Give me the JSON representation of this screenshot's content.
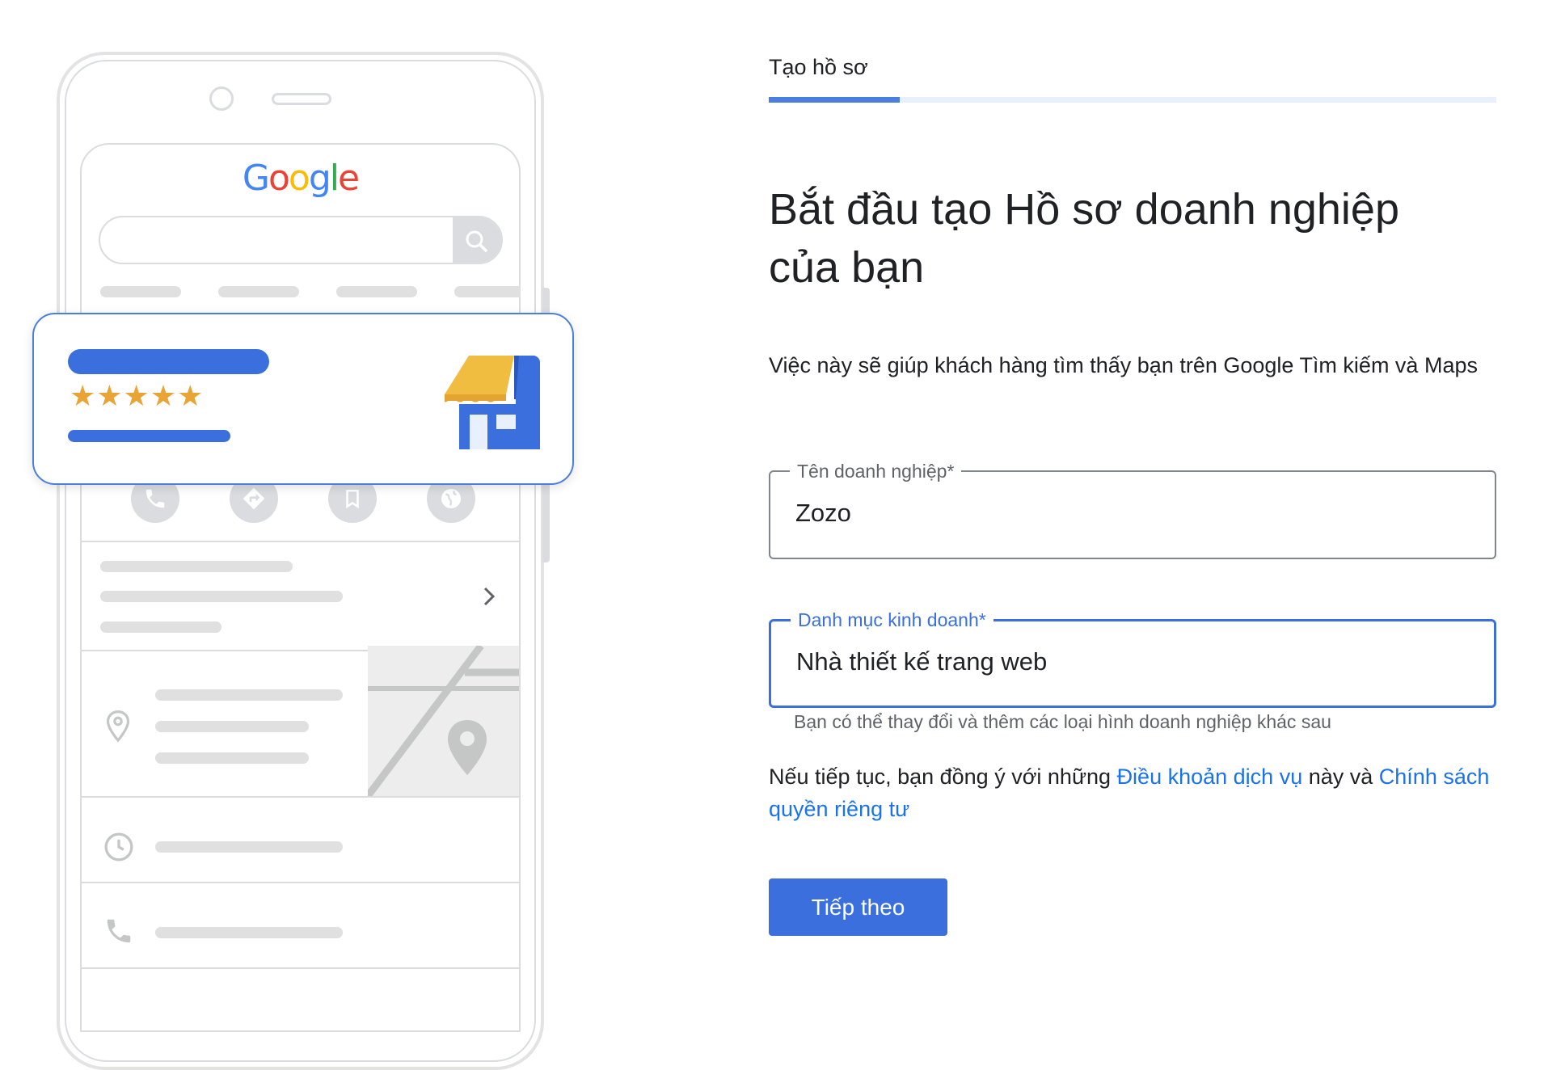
{
  "illustration": {
    "logo_text": "Google",
    "logo_colors": [
      "#4285F4",
      "#EA4335",
      "#FBBC05",
      "#4285F4",
      "#34A853",
      "#EA4335"
    ],
    "stars": "★★★★★",
    "star_color": "#e9a435",
    "accent": "#3b6fde"
  },
  "form": {
    "step_label": "Tạo hồ sơ",
    "progress_fraction": 0.18,
    "heading_line1": "Bắt đầu tạo Hồ sơ doanh nghiệp",
    "heading_line2": "của bạn",
    "description": "Việc này sẽ giúp khách hàng tìm thấy bạn trên Google Tìm kiếm và Maps",
    "business_name": {
      "label": "Tên doanh nghiệp*",
      "value": "Zozo"
    },
    "business_category": {
      "label": "Danh mục kinh doanh*",
      "value": "Nhà thiết kế trang web",
      "helper": "Bạn có thể thay đổi và thêm các loại hình doanh nghiệp khác sau"
    },
    "terms": {
      "prefix": "Nếu tiếp tục, bạn đồng ý với những ",
      "tos_link": "Điều khoản dịch vụ",
      "middle": " này và ",
      "privacy_link": "Chính sách quyền riêng tư"
    },
    "next_button": "Tiếp theo"
  }
}
